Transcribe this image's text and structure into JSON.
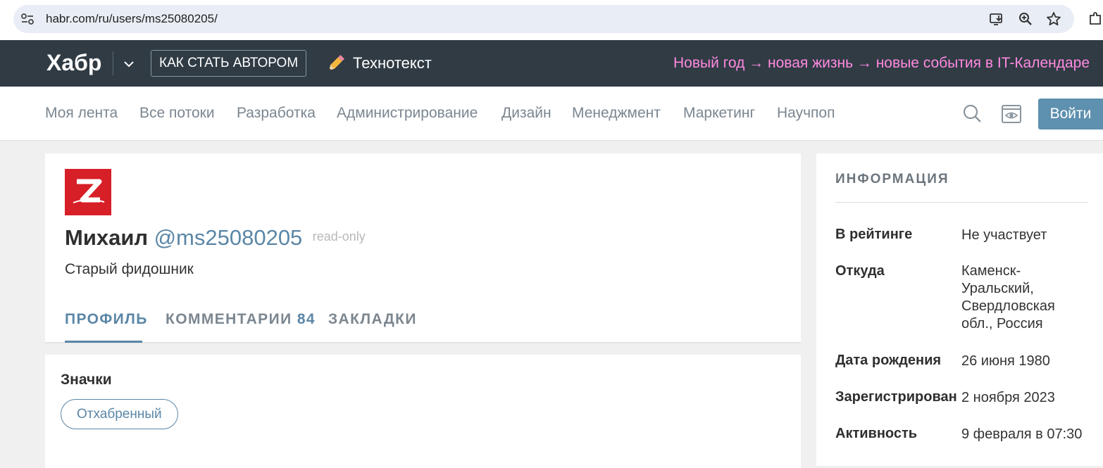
{
  "browser": {
    "url": "habr.com/ru/users/ms25080205/"
  },
  "header": {
    "logo": "Хабр",
    "author_button": "КАК СТАТЬ АВТОРОМ",
    "technotext": "Технотекст",
    "promo": "Новый год → новая жизнь → новые события в IT-Календаре"
  },
  "nav": {
    "items": [
      "Моя лента",
      "Все потоки",
      "Разработка",
      "Администрирование",
      "Дизайн",
      "Менеджмент",
      "Маркетинг",
      "Научпоп"
    ],
    "login": "Войти"
  },
  "profile": {
    "name": "Михаил",
    "handle": "@ms25080205",
    "status": "read-only",
    "specialization": "Старый фидошник",
    "avatar_color": "#d71f27",
    "tabs": {
      "profile": "ПРОФИЛЬ",
      "comments": "КОММЕНТАРИИ",
      "comments_count": "84",
      "bookmarks": "ЗАКЛАДКИ"
    }
  },
  "badges": {
    "title": "Значки",
    "items": [
      "Отхабренный"
    ]
  },
  "info": {
    "title": "ИНФОРМАЦИЯ",
    "rows": [
      {
        "label": "В рейтинге",
        "value": "Не участвует"
      },
      {
        "label": "Откуда",
        "value": "Каменск-Уральский, Свердловская обл., Россия"
      },
      {
        "label": "Дата рождения",
        "value": "26 июня 1980"
      },
      {
        "label": "Зарегистрирован",
        "value": "2 ноября 2023"
      },
      {
        "label": "Активность",
        "value": "9 февраля в 07:30"
      }
    ]
  },
  "colors": {
    "header_bg": "#303b44",
    "accent": "#5b86a6",
    "login_button": "#5e90af",
    "promo_text": "#ff8ae0"
  }
}
